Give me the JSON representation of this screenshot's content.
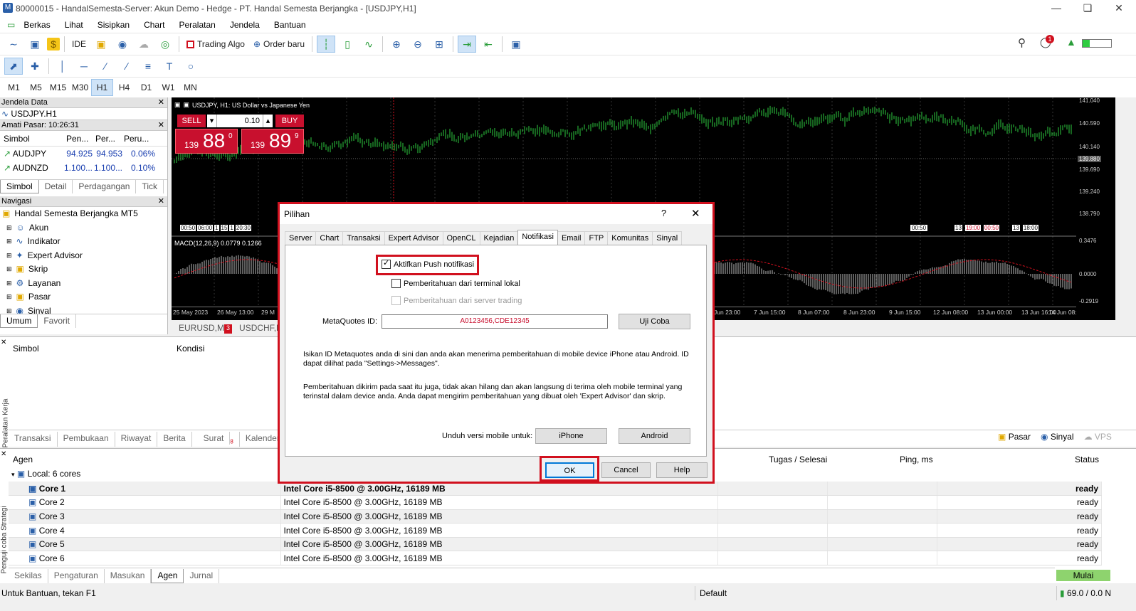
{
  "window": {
    "title": "80000015 - HandalSemesta-Server: Akun Demo - Hedge - PT. Handal Semesta Berjangka - [USDJPY,H1]"
  },
  "menu": [
    "Berkas",
    "Lihat",
    "Sisipkan",
    "Chart",
    "Peralatan",
    "Jendela",
    "Bantuan"
  ],
  "toolbar": {
    "ide": "IDE",
    "trading_algo": "Trading Algo",
    "order_baru": "Order baru",
    "notif_count": "1"
  },
  "timeframes": [
    "M1",
    "M5",
    "M15",
    "M30",
    "H1",
    "H4",
    "D1",
    "W1",
    "MN"
  ],
  "data_window": {
    "title": "Jendela Data",
    "symbol": "USDJPY.H1"
  },
  "market_watch": {
    "title": "Amati Pasar: 10:26:31",
    "cols": [
      "Simbol",
      "Pen...",
      "Per...",
      "Peru..."
    ],
    "rows": [
      [
        "AUDJPY",
        "94.925",
        "94.953",
        "0.06%"
      ],
      [
        "AUDNZD",
        "1.100...",
        "1.100...",
        "0.10%"
      ]
    ],
    "tabs": [
      "Simbol",
      "Detail",
      "Perdagangan",
      "Tick"
    ]
  },
  "navigator": {
    "title": "Navigasi",
    "root": "Handal Semesta Berjangka MT5",
    "items": [
      "Akun",
      "Indikator",
      "Expert Advisor",
      "Skrip",
      "Layanan",
      "Pasar",
      "Sinyal"
    ],
    "tabs": [
      "Umum",
      "Favorit"
    ]
  },
  "chart": {
    "header": "USDJPY, H1:  US Dollar vs Japanese Yen",
    "sell": "SELL",
    "buy": "BUY",
    "lot": "0.10",
    "sell_big": "139",
    "sell_mid": "88",
    "sell_sup": "0",
    "buy_big": "139",
    "buy_mid": "89",
    "buy_sup": "9",
    "macd": "MACD(12,26,9) 0.0779 0.1266",
    "y_labels": [
      "141.040",
      "140.590",
      "140.140",
      "139.690",
      "139.240",
      "138.790"
    ],
    "price_tag": "139.880",
    "macd_labels": [
      "0.3476",
      "0.0000",
      "-0.2919"
    ],
    "x_labels_left": [
      "25 May 2023",
      "26 May 13:00",
      "29 M"
    ],
    "x_labels_right": [
      "Jun 23:00",
      "7 Jun 15:00",
      "8 Jun 07:00",
      "8 Jun 23:00",
      "9 Jun 15:00",
      "12 Jun 08:00",
      "13 Jun 00:00",
      "13 Jun 16:00",
      "14 Jun 08:00"
    ],
    "tabs": [
      "EURUSD,M",
      "USDCHF,H"
    ],
    "tab_badge": "3",
    "time_tags_left": [
      "00:50",
      "06:00",
      "1",
      "15",
      "1",
      "20:30"
    ],
    "time_tags_right": [
      "00:50",
      "13",
      "19:00",
      "00:50",
      "13",
      "18:00"
    ]
  },
  "alerts": {
    "cols": [
      "Simbol",
      "Kondisi"
    ],
    "tabs": [
      "Transaksi",
      "Pembukaan",
      "Riwayat",
      "Berita",
      "Surat",
      "Kalender"
    ],
    "surat_badge": "8",
    "side_label": "Peralatan Kerja",
    "right": [
      "Pasar",
      "Sinyal",
      "VPS"
    ]
  },
  "dialog": {
    "title": "Pilihan",
    "help": "?",
    "tabs": [
      "Server",
      "Chart",
      "Transaksi",
      "Expert Advisor",
      "OpenCL",
      "Kejadian",
      "Notifikasi",
      "Email",
      "FTP",
      "Komunitas",
      "Sinyal"
    ],
    "push_label": "Aktifkan Push notifikasi",
    "local_label": "Pemberitahuan dari terminal lokal",
    "server_label": "Pemberitahuan dari server trading",
    "mq_label": "MetaQuotes ID:",
    "mq_value": "A0123456,CDE12345",
    "test_btn": "Uji Coba",
    "info1": "Isikan ID Metaquotes anda di sini dan anda akan menerima pemberitahuan di mobile device iPhone atau Android. ID dapat dilihat pada \"Settings->Messages\".",
    "info2": "Pemberitahuan dikirim pada saat itu juga, tidak akan hilang dan akan langsung di terima oleh mobile terminal yang terinstal dalam device anda. Anda dapat mengirim pemberitahuan yang dibuat oleh 'Expert Advisor' dan skrip.",
    "download_label": "Unduh versi mobile untuk:",
    "iphone": "iPhone",
    "android": "Android",
    "ok": "OK",
    "cancel": "Cancel",
    "helpbtn": "Help"
  },
  "tester": {
    "cols": [
      "Agen",
      "Tugas / Selesai",
      "Ping, ms",
      "Status"
    ],
    "group": "Local: 6 cores",
    "rows": [
      [
        "Core 1",
        "Intel Core i5-8500  @ 3.00GHz, 16189 MB",
        "ready"
      ],
      [
        "Core 2",
        "Intel Core i5-8500  @ 3.00GHz, 16189 MB",
        "ready"
      ],
      [
        "Core 3",
        "Intel Core i5-8500  @ 3.00GHz, 16189 MB",
        "ready"
      ],
      [
        "Core 4",
        "Intel Core i5-8500  @ 3.00GHz, 16189 MB",
        "ready"
      ],
      [
        "Core 5",
        "Intel Core i5-8500  @ 3.00GHz, 16189 MB",
        "ready"
      ],
      [
        "Core 6",
        "Intel Core i5-8500  @ 3.00GHz, 16189 MB",
        "ready"
      ]
    ],
    "tabs": [
      "Sekilas",
      "Pengaturan",
      "Masukan",
      "Agen",
      "Jurnal"
    ],
    "start": "Mulai",
    "side_label": "Penguji coba Strategi"
  },
  "statusbar": {
    "help": "Untuk Bantuan, tekan F1",
    "profile": "Default",
    "traffic": "69.0 / 0.0 N"
  },
  "colors": {
    "accent_red": "#d1101e",
    "candle": "#2ecc40",
    "mulai": "#8ed36e",
    "sell": "#c8102e"
  }
}
